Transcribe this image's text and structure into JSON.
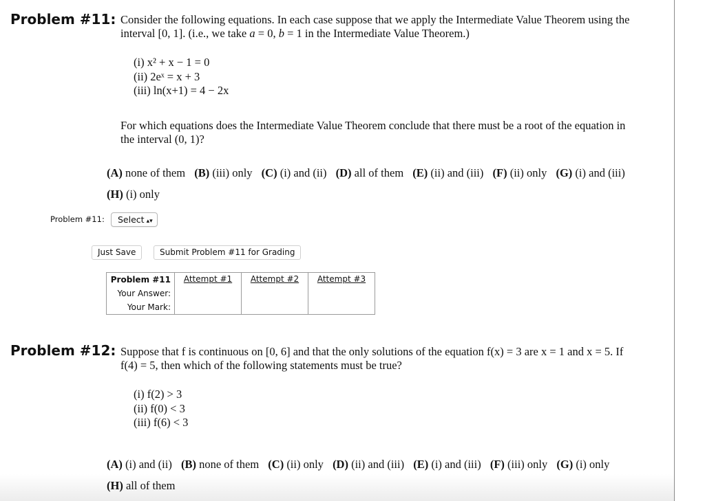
{
  "problem11": {
    "title": "Problem #11:",
    "intro_line1": "Consider the following equations. In each case suppose that we apply the Intermediate Value Theorem using the",
    "intro_line2_parts": [
      "interval [0, 1]. (i.e., we take ",
      "a",
      " = 0, ",
      "b",
      " = 1 in the Intermediate Value Theorem.)"
    ],
    "equations": [
      {
        "label": "(i)",
        "text": "x² + x − 1 = 0"
      },
      {
        "label": "(ii)",
        "text": "2eˣ = x + 3"
      },
      {
        "label": "(iii)",
        "text": "ln(x+1) = 4 − 2x"
      }
    ],
    "question_line1": "For which equations does the Intermediate Value Theorem conclude that there must be a root of the equation in",
    "question_line2": "the interval (0, 1)?",
    "choices": [
      {
        "letter": "(A)",
        "text": "none of them"
      },
      {
        "letter": "(B)",
        "text": "(iii) only"
      },
      {
        "letter": "(C)",
        "text": "(i) and (ii)"
      },
      {
        "letter": "(D)",
        "text": "all of them"
      },
      {
        "letter": "(E)",
        "text": "(ii) and (iii)"
      },
      {
        "letter": "(F)",
        "text": "(ii) only"
      },
      {
        "letter": "(G)",
        "text": "(i) and (iii)"
      },
      {
        "letter": "(H)",
        "text": "(i) only"
      }
    ],
    "answer_label": "Problem #11:",
    "select_value": "Select",
    "just_save_label": "Just Save",
    "submit_label": "Submit Problem #11 for Grading",
    "attempts_table": {
      "header": "Problem #11",
      "attempts": [
        "Attempt #1",
        "Attempt #2",
        "Attempt #3"
      ],
      "row_labels": [
        "Your Answer:",
        "Your Mark:"
      ]
    }
  },
  "problem12": {
    "title": "Problem #12:",
    "intro_line1": "Suppose that f is continuous on [0, 6] and that the only solutions of the equation f(x) = 3 are x = 1 and x = 5. If",
    "intro_line2": "f(4) = 5, then which of the following statements must be true?",
    "statements": [
      {
        "label": "(i)",
        "text": "f(2) > 3"
      },
      {
        "label": "(ii)",
        "text": "f(0) < 3"
      },
      {
        "label": "(iii)",
        "text": "f(6) < 3"
      }
    ],
    "choices": [
      {
        "letter": "(A)",
        "text": "(i) and (ii)"
      },
      {
        "letter": "(B)",
        "text": "none of them"
      },
      {
        "letter": "(C)",
        "text": "(ii) only"
      },
      {
        "letter": "(D)",
        "text": "(ii) and (iii)"
      },
      {
        "letter": "(E)",
        "text": "(i) and (iii)"
      },
      {
        "letter": "(F)",
        "text": "(iii) only"
      },
      {
        "letter": "(G)",
        "text": "(i) only"
      },
      {
        "letter": "(H)",
        "text": "all of them"
      }
    ]
  }
}
